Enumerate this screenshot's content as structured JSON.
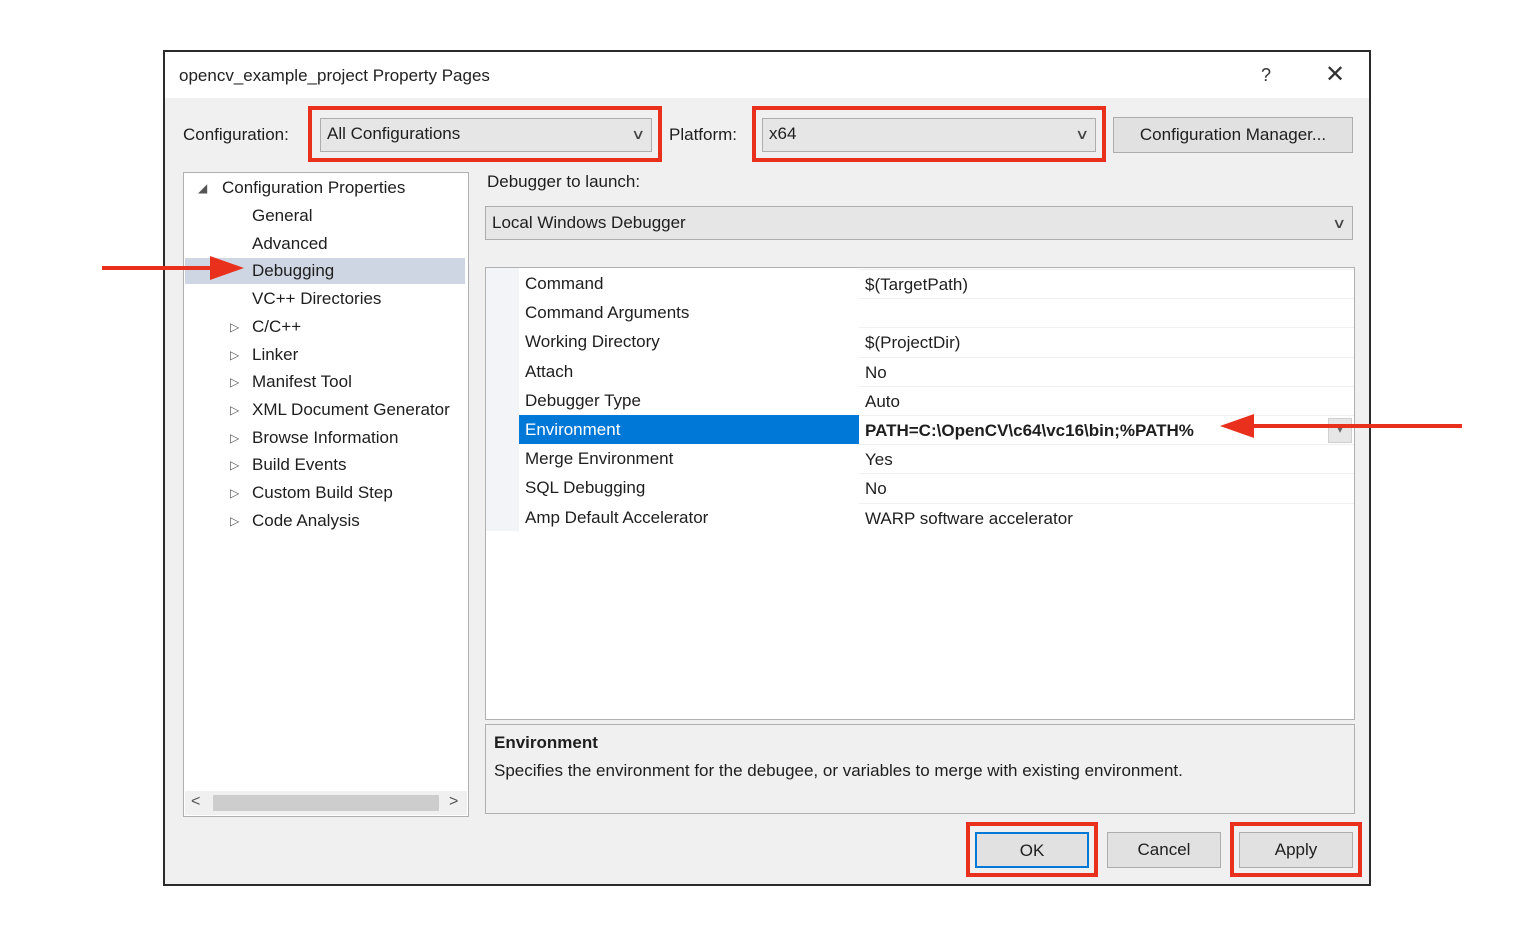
{
  "window": {
    "title": "opencv_example_project Property Pages",
    "help_glyph": "?",
    "close_glyph": "✕"
  },
  "toolbar": {
    "configuration_label": "Configuration:",
    "configuration_value": "All Configurations",
    "platform_label": "Platform:",
    "platform_value": "x64",
    "config_manager_label": "Configuration Manager..."
  },
  "tree": {
    "root": "Configuration Properties",
    "items": [
      {
        "label": "General",
        "expandable": false
      },
      {
        "label": "Advanced",
        "expandable": false
      },
      {
        "label": "Debugging",
        "expandable": false,
        "selected": true
      },
      {
        "label": "VC++ Directories",
        "expandable": false
      },
      {
        "label": "C/C++",
        "expandable": true
      },
      {
        "label": "Linker",
        "expandable": true
      },
      {
        "label": "Manifest Tool",
        "expandable": true
      },
      {
        "label": "XML Document Generator",
        "expandable": true
      },
      {
        "label": "Browse Information",
        "expandable": true
      },
      {
        "label": "Build Events",
        "expandable": true
      },
      {
        "label": "Custom Build Step",
        "expandable": true
      },
      {
        "label": "Code Analysis",
        "expandable": true
      }
    ]
  },
  "debugger": {
    "launch_label": "Debugger to launch:",
    "launch_value": "Local Windows Debugger"
  },
  "properties": [
    {
      "name": "Command",
      "value": "$(TargetPath)"
    },
    {
      "name": "Command Arguments",
      "value": ""
    },
    {
      "name": "Working Directory",
      "value": "$(ProjectDir)"
    },
    {
      "name": "Attach",
      "value": "No"
    },
    {
      "name": "Debugger Type",
      "value": "Auto"
    },
    {
      "name": "Environment",
      "value": "PATH=C:\\OpenCV\\c64\\vc16\\bin;%PATH%",
      "selected": true
    },
    {
      "name": "Merge Environment",
      "value": "Yes"
    },
    {
      "name": "SQL Debugging",
      "value": "No"
    },
    {
      "name": "Amp Default Accelerator",
      "value": "WARP software accelerator"
    }
  ],
  "description": {
    "title": "Environment",
    "text": "Specifies the environment for the debugee, or variables to merge with existing environment."
  },
  "buttons": {
    "ok": "OK",
    "cancel": "Cancel",
    "apply": "Apply"
  },
  "colors": {
    "annotation_red": "#e8301c",
    "selection_blue": "#0078d7"
  }
}
